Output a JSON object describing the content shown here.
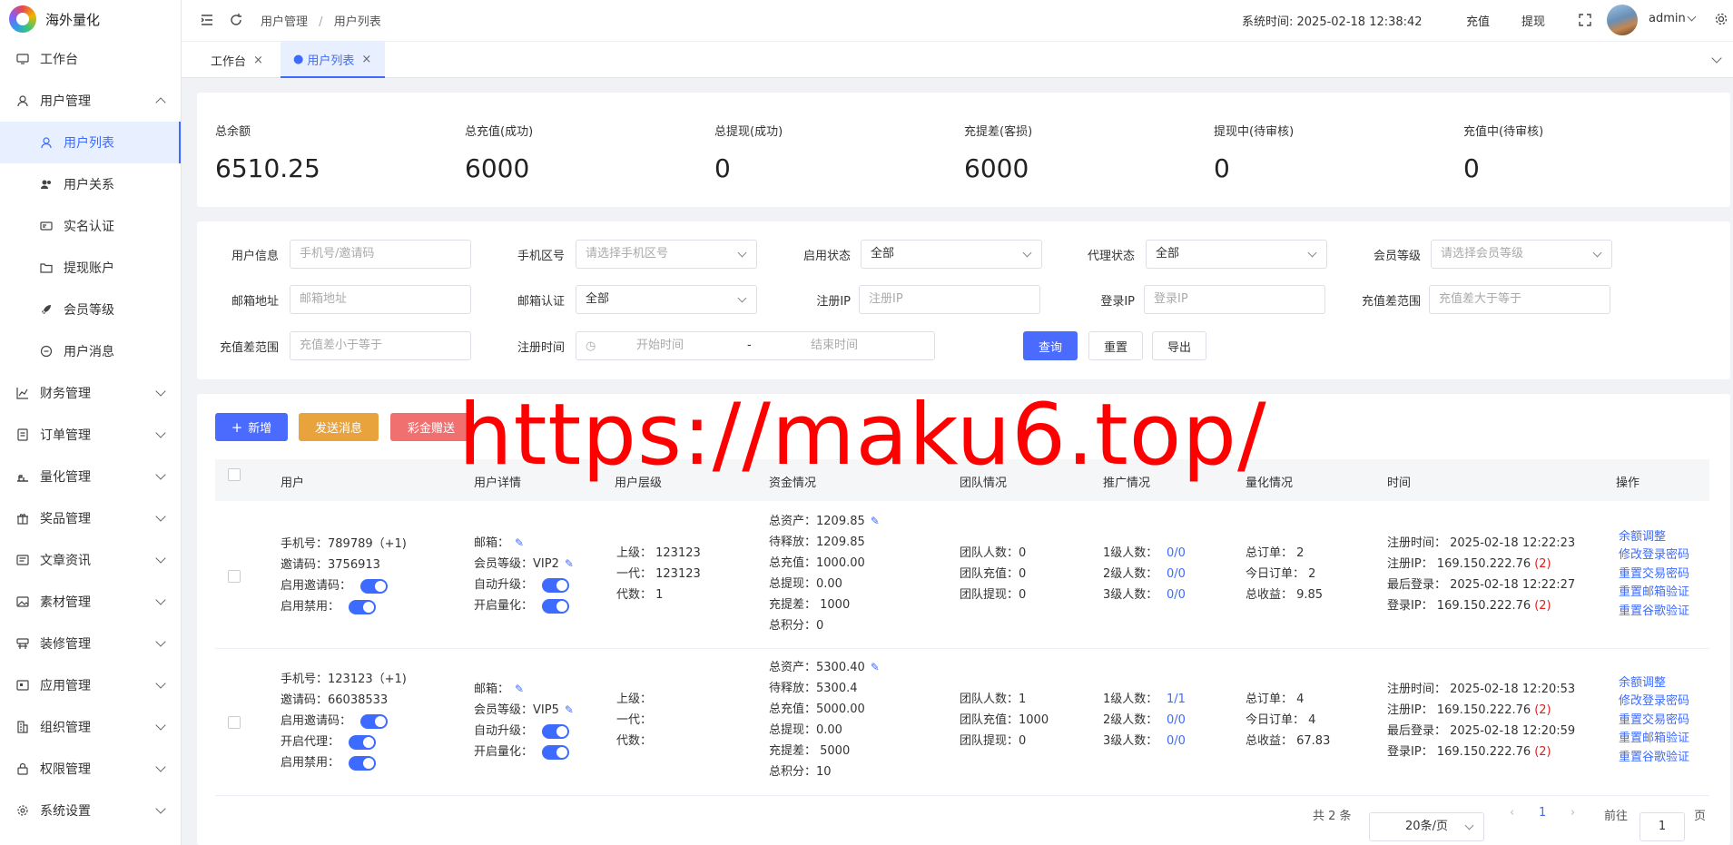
{
  "app": {
    "name": "海外量化"
  },
  "sidebar": {
    "items": [
      {
        "label": "工作台",
        "icon": "monitor-icon"
      },
      {
        "label": "用户管理",
        "icon": "user-icon"
      },
      {
        "label": "用户列表",
        "icon": "user-list-icon"
      },
      {
        "label": "用户关系",
        "icon": "users-icon"
      },
      {
        "label": "实名认证",
        "icon": "id-card-icon"
      },
      {
        "label": "提现账户",
        "icon": "folder-icon"
      },
      {
        "label": "会员等级",
        "icon": "rocket-icon"
      },
      {
        "label": "用户消息",
        "icon": "message-icon"
      },
      {
        "label": "财务管理",
        "icon": "chart-icon"
      },
      {
        "label": "订单管理",
        "icon": "order-icon"
      },
      {
        "label": "量化管理",
        "icon": "quant-icon"
      },
      {
        "label": "奖品管理",
        "icon": "gift-icon"
      },
      {
        "label": "文章资讯",
        "icon": "article-icon"
      },
      {
        "label": "素材管理",
        "icon": "image-icon"
      },
      {
        "label": "装修管理",
        "icon": "decor-icon"
      },
      {
        "label": "应用管理",
        "icon": "app-icon"
      },
      {
        "label": "组织管理",
        "icon": "org-icon"
      },
      {
        "label": "权限管理",
        "icon": "lock-icon"
      },
      {
        "label": "系统设置",
        "icon": "gear-icon"
      }
    ]
  },
  "header": {
    "breadcrumb": [
      "用户管理",
      "用户列表"
    ],
    "system_time_label": "系统时间: 2025-02-18 12:38:42",
    "recharge": "充值",
    "withdraw": "提现",
    "username": "admin"
  },
  "tabs": [
    {
      "label": "工作台"
    },
    {
      "label": "用户列表"
    }
  ],
  "stats": [
    {
      "label": "总余额",
      "value": "6510.25"
    },
    {
      "label": "总充值(成功)",
      "value": "6000"
    },
    {
      "label": "总提现(成功)",
      "value": "0"
    },
    {
      "label": "充提差(客损)",
      "value": "6000"
    },
    {
      "label": "提现中(待审核)",
      "value": "0"
    },
    {
      "label": "充值中(待审核)",
      "value": "0"
    }
  ],
  "filters": {
    "user_info": {
      "label": "用户信息",
      "placeholder": "手机号/邀请码"
    },
    "phone_area": {
      "label": "手机区号",
      "placeholder": "请选择手机区号"
    },
    "enable_status": {
      "label": "启用状态",
      "value": "全部"
    },
    "agent_status": {
      "label": "代理状态",
      "value": "全部"
    },
    "member_level": {
      "label": "会员等级",
      "placeholder": "请选择会员等级"
    },
    "email": {
      "label": "邮箱地址",
      "placeholder": "邮箱地址"
    },
    "email_verify": {
      "label": "邮箱认证",
      "value": "全部"
    },
    "reg_ip": {
      "label": "注册IP",
      "placeholder": "注册IP"
    },
    "login_ip": {
      "label": "登录IP",
      "placeholder": "登录IP"
    },
    "diff_min": {
      "label": "充值差范围",
      "placeholder": "充值差大于等于"
    },
    "diff_max": {
      "label": "充值差范围",
      "placeholder": "充值差小于等于"
    },
    "reg_time": {
      "label": "注册时间",
      "start": "开始时间",
      "sep": "-",
      "end": "结束时间"
    },
    "query": "查询",
    "reset": "重置",
    "export": "导出"
  },
  "actions": {
    "add": "新增",
    "send_msg": "发送消息",
    "bonus": "彩金赠送"
  },
  "table": {
    "headers": [
      "用户",
      "用户详情",
      "用户层级",
      "资金情况",
      "团队情况",
      "推广情况",
      "量化情况",
      "时间",
      "操作"
    ],
    "rows": [
      {
        "user": [
          "手机号：789789（+1)",
          "邀请码：3756913",
          "启用邀请码：",
          "启用禁用："
        ],
        "detail": [
          "邮箱：",
          "会员等级：VIP2",
          "自动升级：",
          "开启量化："
        ],
        "level": [
          "上级：  123123",
          "一代：  123123",
          "代数：  1"
        ],
        "funds": [
          "总资产：1209.85",
          "待释放：1209.85",
          "总充值：1000.00",
          "总提现：0.00",
          "充提差：  1000",
          "总积分：0"
        ],
        "team": [
          "团队人数：0",
          "团队充值：0",
          "团队提现：0"
        ],
        "promo_labels": [
          "1级人数：",
          "2级人数：",
          "3级人数："
        ],
        "promo_values": [
          "0/0",
          "0/0",
          "0/0"
        ],
        "quant": [
          "总订单：  2",
          "今日订单：  2",
          "总收益：  9.85"
        ],
        "time": [
          "注册时间：  2025-02-18 12:22:23",
          "注册IP：  169.150.222.76",
          "最后登录：  2025-02-18 12:22:27",
          "登录IP：  169.150.222.76"
        ],
        "ip_count": "(2)",
        "ops": [
          "余额调整",
          "修改登录密码",
          "重置交易密码",
          "重置邮箱验证",
          "重置谷歌验证"
        ]
      },
      {
        "user": [
          "手机号：123123（+1)",
          "邀请码：66038533",
          "启用邀请码：",
          "开启代理：",
          "启用禁用："
        ],
        "detail": [
          "邮箱：",
          "会员等级：VIP5",
          "自动升级：",
          "开启量化："
        ],
        "level": [
          "上级：",
          "一代：",
          "代数："
        ],
        "funds": [
          "总资产：5300.40",
          "待释放：5300.4",
          "总充值：5000.00",
          "总提现：0.00",
          "充提差：  5000",
          "总积分：10"
        ],
        "team": [
          "团队人数：1",
          "团队充值：1000",
          "团队提现：0"
        ],
        "promo_labels": [
          "1级人数：",
          "2级人数：",
          "3级人数："
        ],
        "promo_values": [
          "1/1",
          "0/0",
          "0/0"
        ],
        "quant": [
          "总订单：  4",
          "今日订单：  4",
          "总收益：  67.83"
        ],
        "time": [
          "注册时间：  2025-02-18 12:20:53",
          "注册IP：  169.150.222.76",
          "最后登录：  2025-02-18 12:20:59",
          "登录IP：  169.150.222.76"
        ],
        "ip_count": "(2)",
        "ops": [
          "余额调整",
          "修改登录密码",
          "重置交易密码",
          "重置邮箱验证",
          "重置谷歌验证"
        ]
      }
    ]
  },
  "pager": {
    "total": "共 2 条",
    "page_size": "20条/页",
    "current": "1",
    "goto": "前往",
    "goto_value": "1",
    "page_suffix": "页"
  },
  "watermark": "https://maku6.top/"
}
